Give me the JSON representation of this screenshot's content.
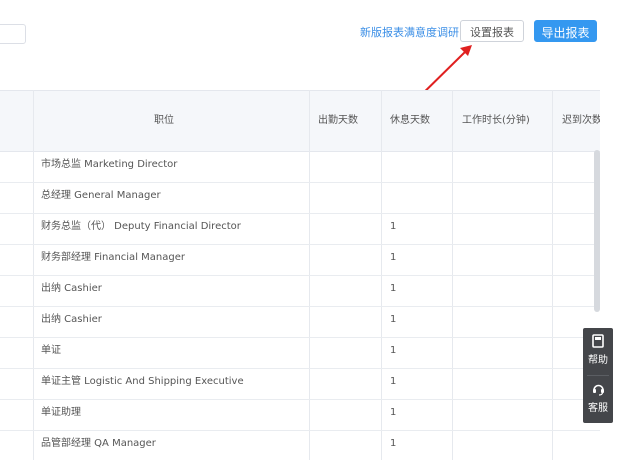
{
  "toolbar": {
    "survey_link": "新版报表满意度调研",
    "settings_button": "设置报表",
    "export_button": "导出报表"
  },
  "table": {
    "headers": {
      "position": "职位",
      "attendance_days": "出勤天数",
      "rest_days": "休息天数",
      "work_hours": "工作时长(分钟)",
      "late_times": "迟到次数"
    },
    "rows": [
      {
        "position": "市场总监 Marketing Director",
        "rest_days": ""
      },
      {
        "position": "总经理 General Manager",
        "rest_days": ""
      },
      {
        "position": "财务总监（代） Deputy Financial Director",
        "rest_days": "1"
      },
      {
        "position": "财务部经理 Financial Manager",
        "rest_days": "1"
      },
      {
        "position": "出纳 Cashier",
        "rest_days": "1"
      },
      {
        "position": "出纳 Cashier",
        "rest_days": "1"
      },
      {
        "position": "单证",
        "rest_days": "1"
      },
      {
        "position": "单证主管 Logistic And Shipping Executive",
        "rest_days": "1"
      },
      {
        "position": "单证助理",
        "rest_days": "1"
      },
      {
        "position": "品管部经理 QA Manager",
        "rest_days": "1"
      }
    ]
  },
  "side_panel": {
    "help_label": "帮助",
    "service_label": "客服"
  },
  "colors": {
    "accent": "#3498f0",
    "annotation_arrow": "#e02020",
    "side_panel": "#44464a"
  }
}
